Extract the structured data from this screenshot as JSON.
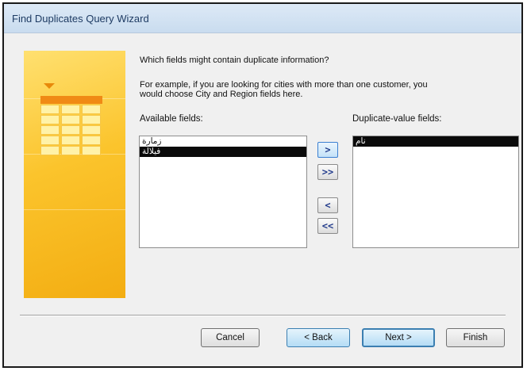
{
  "window": {
    "title": "Find Duplicates Query Wizard"
  },
  "prompt": {
    "question": "Which fields might contain duplicate information?",
    "example_line1": "For example, if you are looking for cities with more than one customer, you",
    "example_line2": "would choose City and Region fields here."
  },
  "available": {
    "label": "Available fields:",
    "items": [
      {
        "text": "زمارة"
      },
      {
        "text": "فيلالة"
      }
    ],
    "selected_index": 1
  },
  "duplicate": {
    "label": "Duplicate-value fields:",
    "items": [
      {
        "text": "نام"
      }
    ],
    "selected_index": 0
  },
  "move_buttons": {
    "add_one": ">",
    "add_all": ">>",
    "remove_one": "<",
    "remove_all": "<<"
  },
  "buttons": {
    "cancel": "Cancel",
    "back": "< Back",
    "next": "Next >",
    "finish": "Finish"
  }
}
